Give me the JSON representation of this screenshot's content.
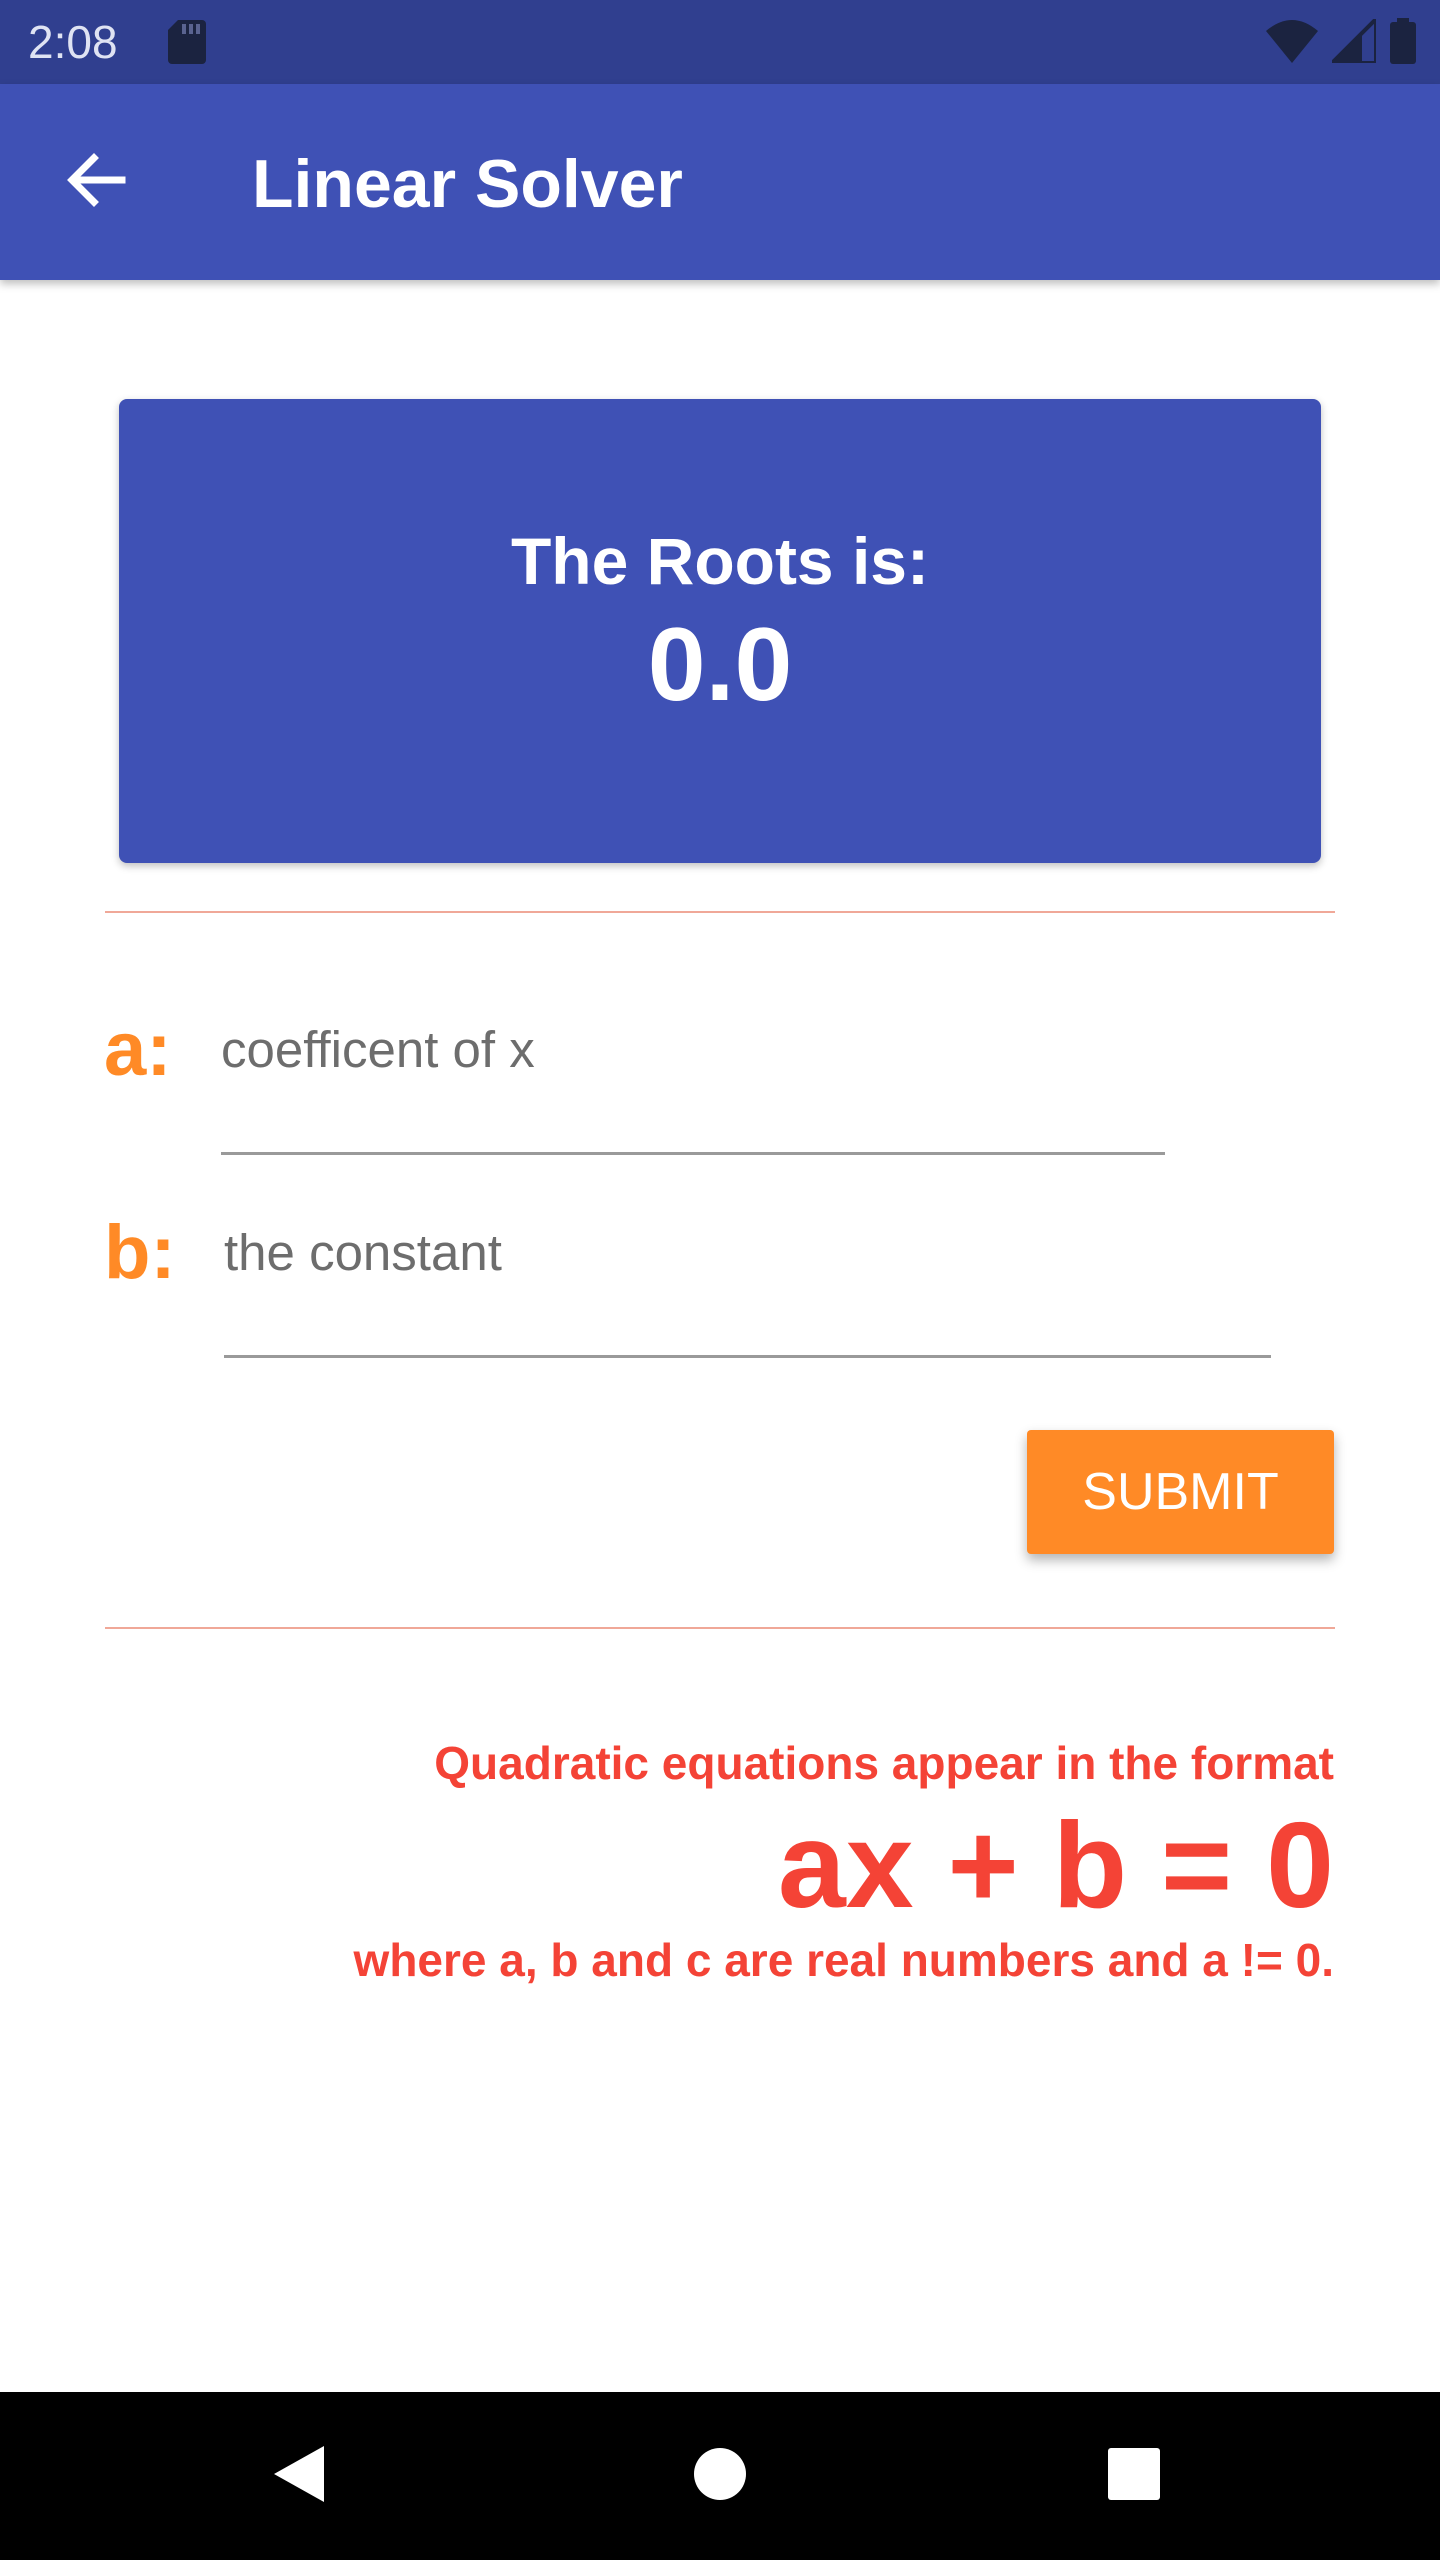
{
  "status_bar": {
    "time": "2:08",
    "icons": [
      "sd-card-icon",
      "wifi-icon",
      "signal-icon",
      "battery-icon"
    ]
  },
  "app_bar": {
    "title": "Linear Solver",
    "back_icon": "arrow-back-icon"
  },
  "result": {
    "label": "The Roots is:",
    "value": "0.0"
  },
  "inputs": {
    "a": {
      "label": "a:",
      "placeholder": "coefficent of x",
      "value": ""
    },
    "b": {
      "label": "b:",
      "placeholder": "the constant",
      "value": ""
    }
  },
  "submit": {
    "label": "SUBMIT"
  },
  "info": {
    "line1": "Quadratic equations appear in the format",
    "formula": "ax + b = 0",
    "line3": "where a, b and c are real numbers and a != 0."
  },
  "navigation": {
    "icons": [
      "back-triangle-icon",
      "home-circle-icon",
      "recents-square-icon"
    ]
  },
  "colors": {
    "primary": "#3f51b5",
    "primary_dark": "#303f8f",
    "accent": "#ff8a26",
    "info_text": "#f44336"
  }
}
